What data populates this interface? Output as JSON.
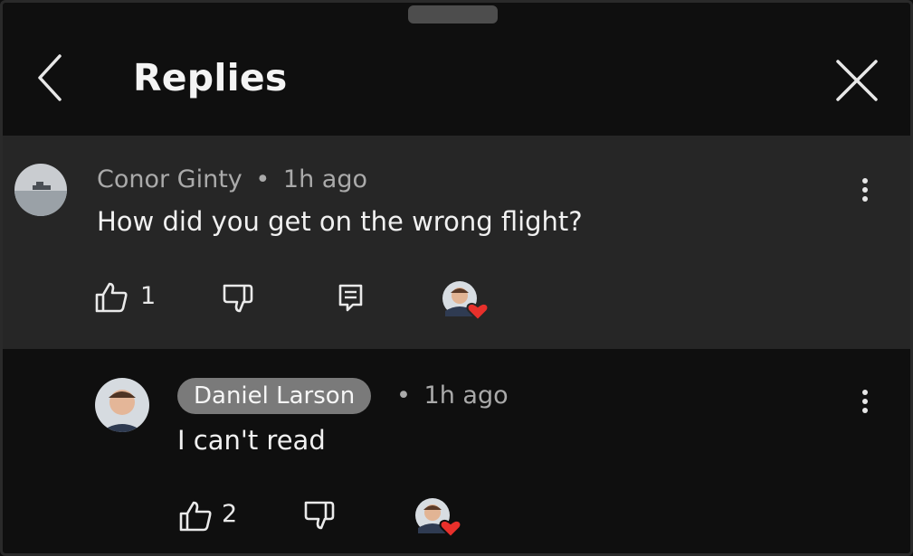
{
  "header": {
    "title": "Replies"
  },
  "parent_comment": {
    "author": "Conor Ginty",
    "separator": "•",
    "time": "1h ago",
    "text": "How did you get on the wrong flight?",
    "likes": "1"
  },
  "reply": {
    "author": "Daniel Larson",
    "separator": "•",
    "time": "1h ago",
    "text": "I can't read",
    "likes": "2"
  },
  "colors": {
    "background": "#0f0f0f",
    "parent_background": "#262626",
    "author_pill": "#7a7a7a",
    "heart": "#e8302b"
  },
  "icons": [
    "back-chevron-icon",
    "close-icon",
    "thumbs-up-icon",
    "thumbs-down-icon",
    "reply-icon",
    "creator-heart-icon",
    "more-vertical-icon"
  ]
}
